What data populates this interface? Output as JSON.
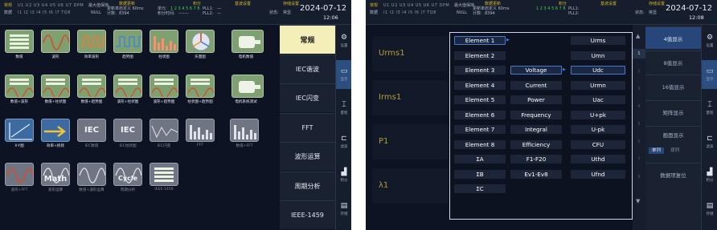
{
  "status": {
    "mode_top": "常规",
    "mode_bottom": "数据",
    "channels_top": [
      "U1",
      "U2",
      "U3",
      "U4",
      "U5",
      "U6",
      "U7",
      "DPM"
    ],
    "channels_bottom": [
      "I1",
      "I2",
      "I3",
      "I4",
      "I5",
      "I6",
      "I7",
      "TQ8"
    ],
    "hold_label": "最大值保持",
    "hold_value": "NULL",
    "update_label": "数据更新",
    "update_rate_label": "更新率:",
    "update_rate_value": "自定义 60ms",
    "count_label": "计数:",
    "count_value": "8394",
    "integ_label": "积分",
    "unit_label": "单元:",
    "integ_time_label": "积分时间:",
    "integ_time_value": "-------",
    "pll_label": "PLL1:",
    "pll2_label": "PLL2:",
    "pll_value": "—",
    "filter_label": "基波设置",
    "store_label": "存储设置",
    "status_label": "状态:",
    "status_value": "常显",
    "date": "2024-07-12",
    "time": "12:06",
    "time_b": "12:08",
    "seg_numbers": [
      "1",
      "2",
      "3",
      "4",
      "5",
      "6",
      "7",
      "8"
    ]
  },
  "screen_a": {
    "tiles": [
      {
        "label": "数值"
      },
      {
        "label": "波形"
      },
      {
        "label": "效率波形"
      },
      {
        "label": "趋势图"
      },
      {
        "label": "柱状图"
      },
      {
        "label": "矢量图"
      },
      {
        "label": "电机数值"
      },
      {
        "label": "数值+波形"
      },
      {
        "label": "数值+柱状图"
      },
      {
        "label": "数值+趋势图"
      },
      {
        "label": "波形+柱状图"
      },
      {
        "label": "波形+趋势图"
      },
      {
        "label": "柱状图+趋势图"
      },
      {
        "label": "电机系统测试"
      },
      {
        "label": "X-Y图"
      },
      {
        "label": "效率+损耗"
      },
      {
        "label": "IEC数值"
      },
      {
        "label": "IEC柱状图"
      },
      {
        "label": "IEC闪变"
      },
      {
        "label": "FFT"
      },
      {
        "label": "数值+FFT"
      },
      {
        "label": "波形+FFT"
      },
      {
        "label": "波形运算"
      },
      {
        "label": "数值+波形运算"
      },
      {
        "label": "周期分析"
      },
      {
        "label": "IEEE-1459"
      }
    ],
    "tile_texts": {
      "iec": "IEC",
      "math": "Math",
      "cycle": "Cycle"
    },
    "menu": [
      "常规",
      "IEC谐波",
      "IEC闪变",
      "FFT",
      "波形运算",
      "周期分析",
      "IEEE-1459"
    ],
    "sidebar": [
      {
        "icon": "⚙",
        "label": "设置"
      },
      {
        "icon": "▭",
        "label": "显示"
      },
      {
        "icon": "⌶",
        "label": "量程"
      },
      {
        "icon": "⊏",
        "label": "滤波"
      },
      {
        "icon": "▟",
        "label": "积分"
      },
      {
        "icon": "▤",
        "label": "存储"
      }
    ]
  },
  "screen_b": {
    "panels": [
      "Urms1",
      "Irms1",
      "P1",
      "λ1"
    ],
    "col1": [
      "Element 1",
      "Element 2",
      "Element 3",
      "Element 4",
      "Element 5",
      "Element 6",
      "Element 7",
      "Element 8",
      "ΣA",
      "ΣB",
      "ΣC"
    ],
    "col2": [
      "Voltage",
      "Current",
      "Power",
      "Frequency",
      "Integral",
      "Efficiency",
      "F1-F20",
      "Ev1-Ev8"
    ],
    "col3": [
      "Urms",
      "Umn",
      "Udc",
      "Urmn",
      "Uac",
      "U+pk",
      "U-pk",
      "CFU",
      "Uthd",
      "Ufnd"
    ],
    "menu": [
      "4值显示",
      "8值显示",
      "16值显示",
      "矩阵显示",
      "画面显示",
      "数据项复位"
    ],
    "seg": [
      "单列",
      "双列"
    ]
  },
  "colors": {
    "accent_yellow": "#f4efb8",
    "active_blue": "#2a4f80",
    "panel_label": "#b89a3d",
    "tile_green": "#7fa070"
  }
}
